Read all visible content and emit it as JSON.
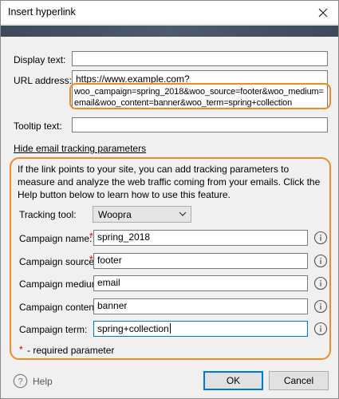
{
  "window": {
    "title": "Insert hyperlink"
  },
  "fields": {
    "display_text": {
      "label": "Display text:",
      "value": ""
    },
    "url": {
      "label": "URL address:",
      "line1": "https://www.example.com?",
      "line2": "woo_campaign=spring_2018&woo_source=footer&woo_medium=",
      "line3": "email&woo_content=banner&woo_term=spring+collection"
    },
    "tooltip": {
      "label": "Tooltip text:",
      "value": ""
    }
  },
  "tracking": {
    "hide_link": "Hide email tracking parameters",
    "info": "If the link points to your site, you can add tracking parameters to measure and analyze the web traffic coming from your emails. Click the Help button below to learn how to use this feature.",
    "tool_label": "Tracking tool:",
    "tool_value": "Woopra",
    "rows": [
      {
        "label": "Campaign name:",
        "required": true,
        "value": "spring_2018"
      },
      {
        "label": "Campaign source:",
        "required": true,
        "value": "footer"
      },
      {
        "label": "Campaign medium:",
        "required": false,
        "value": "email"
      },
      {
        "label": "Campaign content:",
        "required": false,
        "value": "banner"
      },
      {
        "label": "Campaign term:",
        "required": false,
        "value": "spring+collection"
      }
    ],
    "required_mark": "*",
    "required_note": "- required parameter"
  },
  "footer": {
    "help": "Help",
    "ok": "OK",
    "cancel": "Cancel"
  },
  "colors": {
    "highlight": "#f08a24",
    "band": "#4a5668",
    "required": "#d00000",
    "focus": "#0078d7"
  }
}
